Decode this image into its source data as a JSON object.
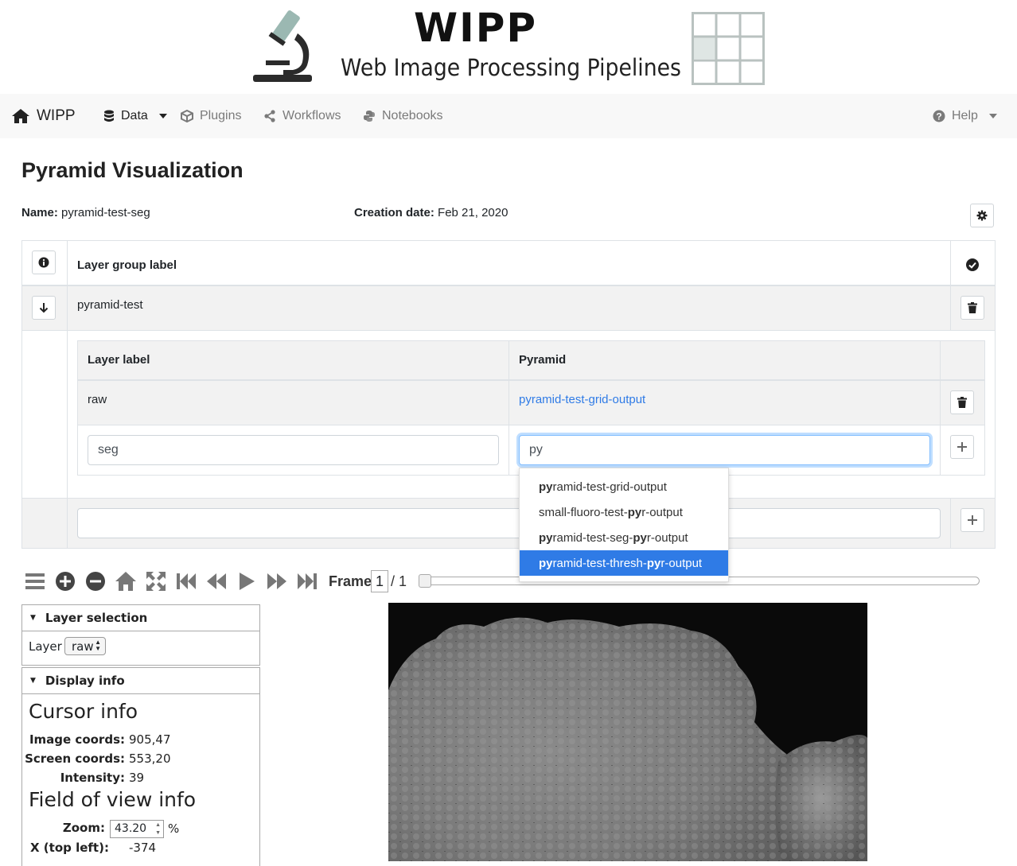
{
  "banner": {
    "title": "WIPP",
    "subtitle": "Web Image Processing Pipelines"
  },
  "navbar": {
    "brand": "WIPP",
    "items": [
      {
        "label": "Data",
        "icon": "database-icon"
      },
      {
        "label": "Plugins",
        "icon": "cube-icon"
      },
      {
        "label": "Workflows",
        "icon": "share-icon"
      },
      {
        "label": "Notebooks",
        "icon": "python-icon"
      }
    ],
    "help": "Help"
  },
  "page": {
    "title": "Pyramid Visualization",
    "name_label": "Name:",
    "name_value": "pyramid-test-seg",
    "date_label": "Creation date:",
    "date_value": "Feb 21, 2020"
  },
  "layer_groups": {
    "header_label": "Layer group label",
    "group_label": "pyramid-test",
    "new_group_value": ""
  },
  "layers_table": {
    "col_layer_label": "Layer label",
    "col_pyramid": "Pyramid",
    "rows": [
      {
        "label": "raw",
        "pyramid": "pyramid-test-grid-output"
      }
    ],
    "new_label_value": "seg",
    "new_pyramid_value": "py"
  },
  "autocomplete": {
    "items": [
      {
        "match": "py",
        "rest": "ramid-test-grid-output",
        "html": "<b>py</b>ramid-test-grid-output"
      },
      {
        "match": "py",
        "rest": "small-fluoro-test-pyr-output",
        "html": "small-fluoro-test-<b>py</b>r-output"
      },
      {
        "match": "py",
        "rest": "pyramid-test-seg-pyr-output",
        "html": "<b>py</b>ramid-test-seg-<b>py</b>r-output"
      },
      {
        "match": "py",
        "rest": "pyramid-test-thresh-pyr-output",
        "html": "<b>py</b>ramid-test-thresh-<b>py</b>r-output"
      }
    ],
    "active_index": 3
  },
  "viewer": {
    "frame_label": "Frame",
    "frame_value": "1",
    "frame_total": "/ 1",
    "frame_progress": 0
  },
  "layer_selection": {
    "title": "Layer selection",
    "layer_label": "Layer",
    "layer_value": "raw"
  },
  "display_info": {
    "title": "Display info",
    "cursor_heading": "Cursor info",
    "image_coords_label": "Image coords:",
    "image_coords_value": "905,47",
    "screen_coords_label": "Screen coords:",
    "screen_coords_value": "553,20",
    "intensity_label": "Intensity:",
    "intensity_value": "39",
    "fov_heading": "Field of view info",
    "zoom_label": "Zoom:",
    "zoom_value": "43.20",
    "zoom_unit": "%",
    "x_top_left_label": "X (top left):",
    "x_top_left_value": "-374"
  }
}
